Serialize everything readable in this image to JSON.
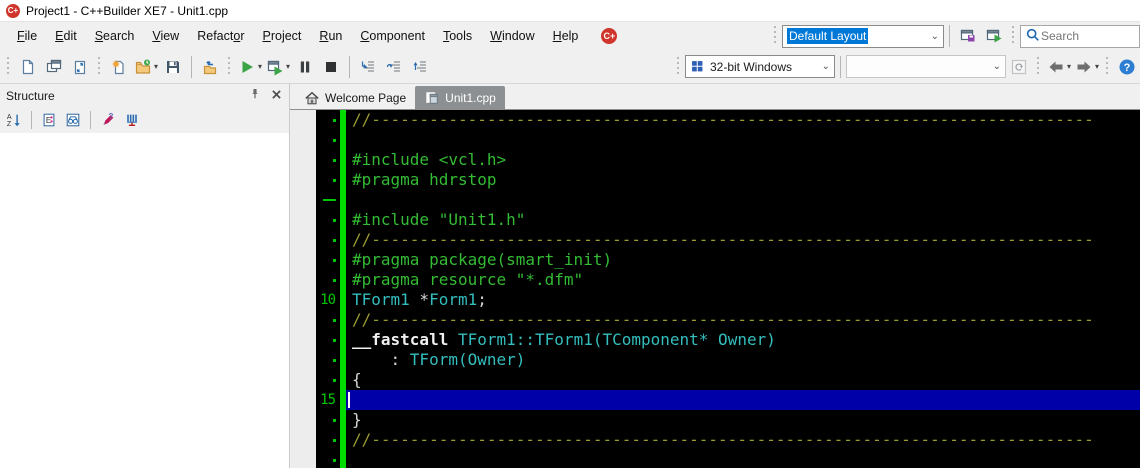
{
  "window": {
    "title": "Project1 - C++Builder XE7 - Unit1.cpp",
    "logo_text": "C+",
    "logo_color": "#d0352b"
  },
  "menu": {
    "items": [
      {
        "pre": "",
        "key": "F",
        "post": "ile"
      },
      {
        "pre": "",
        "key": "E",
        "post": "dit"
      },
      {
        "pre": "",
        "key": "S",
        "post": "earch"
      },
      {
        "pre": "",
        "key": "V",
        "post": "iew"
      },
      {
        "pre": "Refact",
        "key": "o",
        "post": "r"
      },
      {
        "pre": "",
        "key": "P",
        "post": "roject"
      },
      {
        "pre": "",
        "key": "R",
        "post": "un"
      },
      {
        "pre": "",
        "key": "C",
        "post": "omponent"
      },
      {
        "pre": "",
        "key": "T",
        "post": "ools"
      },
      {
        "pre": "",
        "key": "W",
        "post": "indow"
      },
      {
        "pre": "",
        "key": "H",
        "post": "elp"
      }
    ]
  },
  "topbar": {
    "layout_combo": {
      "value": "Default Layout"
    },
    "search": {
      "placeholder": "Search"
    }
  },
  "toolbar": {
    "platform_combo": {
      "value": "32-bit Windows"
    },
    "target_combo": {
      "value": ""
    },
    "sequence": [
      {
        "t": "grip"
      },
      {
        "t": "btn",
        "i": "new-page",
        "n": "new-items-button"
      },
      {
        "t": "btn",
        "i": "windows",
        "n": "new-form-button"
      },
      {
        "t": "btn",
        "i": "page-resize",
        "n": "view-form-button"
      },
      {
        "t": "grip"
      },
      {
        "t": "btn",
        "i": "new-item",
        "n": "new-file-button"
      },
      {
        "t": "btn",
        "i": "open-folder",
        "n": "open-file-button",
        "chev": true
      },
      {
        "t": "btn",
        "i": "save",
        "n": "save-button"
      },
      {
        "t": "sep"
      },
      {
        "t": "btn",
        "i": "open-project",
        "n": "open-project-button"
      },
      {
        "t": "grip"
      },
      {
        "t": "btn",
        "i": "run",
        "n": "run-button",
        "chev": true
      },
      {
        "t": "btn",
        "i": "run-nodebug",
        "n": "run-without-debugging-button",
        "chev": true
      },
      {
        "t": "btn",
        "i": "pause",
        "n": "pause-button"
      },
      {
        "t": "btn",
        "i": "stop",
        "n": "program-reset-button"
      },
      {
        "t": "sep"
      },
      {
        "t": "btn",
        "i": "step-into",
        "n": "trace-into-button"
      },
      {
        "t": "btn",
        "i": "step-over",
        "n": "step-over-button"
      },
      {
        "t": "btn",
        "i": "step-out",
        "n": "run-until-return-button"
      },
      {
        "t": "right"
      },
      {
        "t": "grip"
      },
      {
        "t": "combo",
        "which": "platform",
        "w": 150,
        "icon": "winlogo",
        "n": "target-platform-combo"
      },
      {
        "t": "sep"
      },
      {
        "t": "combo",
        "which": "target",
        "w": 160,
        "disabled": true,
        "n": "target-device-combo"
      },
      {
        "t": "btn",
        "i": "refresh",
        "n": "refresh-devices-button"
      },
      {
        "t": "grip"
      },
      {
        "t": "btn",
        "i": "back",
        "n": "navigate-back-button",
        "chev": true
      },
      {
        "t": "btn",
        "i": "fwd",
        "n": "navigate-forward-button",
        "chev": true
      },
      {
        "t": "grip"
      },
      {
        "t": "btn",
        "i": "help",
        "n": "help-button"
      }
    ]
  },
  "structure": {
    "title": "Structure",
    "buttons": [
      {
        "i": "struct-sort",
        "n": "sort-alphabetically-button"
      },
      {
        "i": "sep"
      },
      {
        "i": "struct-explorer",
        "n": "explorer-options-button"
      },
      {
        "i": "struct-view",
        "n": "view-options-button"
      },
      {
        "i": "sep"
      },
      {
        "i": "struct-modify",
        "n": "modify-button"
      },
      {
        "i": "struct-dock",
        "n": "docking-button"
      }
    ]
  },
  "tabs": {
    "items": [
      {
        "label": "Welcome Page",
        "icon": "home",
        "active": false,
        "n": "tab-welcome-page"
      },
      {
        "label": "Unit1.cpp",
        "icon": "unit",
        "active": true,
        "n": "tab-unit1-cpp"
      }
    ]
  },
  "editor": {
    "colors": {
      "background": "#000000",
      "comment": "#99992e",
      "preprocessor": "#33bb33",
      "identifier": "#33bdbd",
      "plain": "#d8d8d8",
      "keyword": "#f0f0f0",
      "gutter_green": "#00c800",
      "change_bar": "#00dc00",
      "current_line": "#0000a8"
    },
    "lines": [
      {
        "marker": "dot",
        "segments": [
          {
            "c": "comment",
            "t": "//---------------------------------------------------------------------------"
          }
        ]
      },
      {
        "marker": "dot",
        "segments": []
      },
      {
        "marker": "dot",
        "segments": [
          {
            "c": "pre",
            "t": "#include <vcl.h>"
          }
        ]
      },
      {
        "marker": "dot",
        "segments": [
          {
            "c": "pre",
            "t": "#pragma hdrstop"
          }
        ]
      },
      {
        "marker": "dash",
        "segments": []
      },
      {
        "marker": "dot",
        "segments": [
          {
            "c": "pre",
            "t": "#include \"Unit1.h\""
          }
        ]
      },
      {
        "marker": "dot",
        "segments": [
          {
            "c": "comment",
            "t": "//---------------------------------------------------------------------------"
          }
        ]
      },
      {
        "marker": "dot",
        "segments": [
          {
            "c": "pre",
            "t": "#pragma package(smart_init)"
          }
        ]
      },
      {
        "marker": "dot",
        "segments": [
          {
            "c": "pre",
            "t": "#pragma resource \"*.dfm\""
          }
        ]
      },
      {
        "marker": "num",
        "num": "10",
        "segments": [
          {
            "c": "id",
            "t": "TForm1"
          },
          {
            "c": "plain",
            "t": " *"
          },
          {
            "c": "id",
            "t": "Form1"
          },
          {
            "c": "plain",
            "t": ";"
          }
        ]
      },
      {
        "marker": "dot",
        "segments": [
          {
            "c": "comment",
            "t": "//---------------------------------------------------------------------------"
          }
        ]
      },
      {
        "marker": "dot",
        "segments": [
          {
            "c": "kw",
            "t": "__fastcall"
          },
          {
            "c": "plain",
            "t": " "
          },
          {
            "c": "id",
            "t": "TForm1::TForm1(TComponent* Owner)"
          }
        ]
      },
      {
        "marker": "dot",
        "segments": [
          {
            "c": "plain",
            "t": "    : "
          },
          {
            "c": "id",
            "t": "TForm(Owner)"
          }
        ]
      },
      {
        "marker": "dot",
        "segments": [
          {
            "c": "plain",
            "t": "{"
          }
        ]
      },
      {
        "marker": "num",
        "num": "15",
        "current": true,
        "segments": []
      },
      {
        "marker": "dot",
        "segments": [
          {
            "c": "plain",
            "t": "}"
          }
        ]
      },
      {
        "marker": "dot",
        "segments": [
          {
            "c": "comment",
            "t": "//---------------------------------------------------------------------------"
          }
        ]
      },
      {
        "marker": "dot",
        "segments": []
      }
    ]
  }
}
